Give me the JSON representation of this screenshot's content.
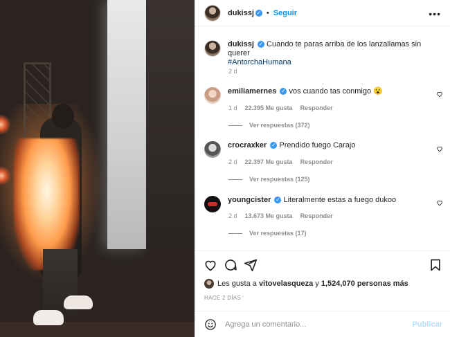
{
  "header": {
    "username": "dukissj",
    "separator": "•",
    "follow_label": "Seguir",
    "more_icon": "more-horizontal-icon"
  },
  "caption": {
    "username": "dukissj",
    "text": "Cuando te paras arriba de los lanzallamas sin querer",
    "hashtag": "#AntorchaHumana",
    "time": "2 d"
  },
  "comments": [
    {
      "username": "emiliamernes",
      "text": "vos cuando tas conmigo 😮",
      "time": "1 d",
      "likes": "22.395 Me gusta",
      "reply": "Responder",
      "view_replies": "Ver respuestas (372)"
    },
    {
      "username": "crocraxker",
      "text": "Prendido fuego Carajo",
      "time": "2 d",
      "likes": "22.397 Me gusta",
      "reply": "Responder",
      "view_replies": "Ver respuestas (125)"
    },
    {
      "username": "youngcister",
      "text": "Literalmente estas a fuego dukoo",
      "time": "2 d",
      "likes": "13.673 Me gusta",
      "reply": "Responder",
      "view_replies": "Ver respuestas (17)"
    }
  ],
  "likes_line": {
    "prefix": "Les gusta a",
    "user": "vitovelasqueza",
    "middle": "y",
    "count": "1,524,070 personas más"
  },
  "time_ago": "HACE 2 DÍAS",
  "add_comment": {
    "placeholder": "Agrega un comentario...",
    "post_label": "Publicar"
  }
}
